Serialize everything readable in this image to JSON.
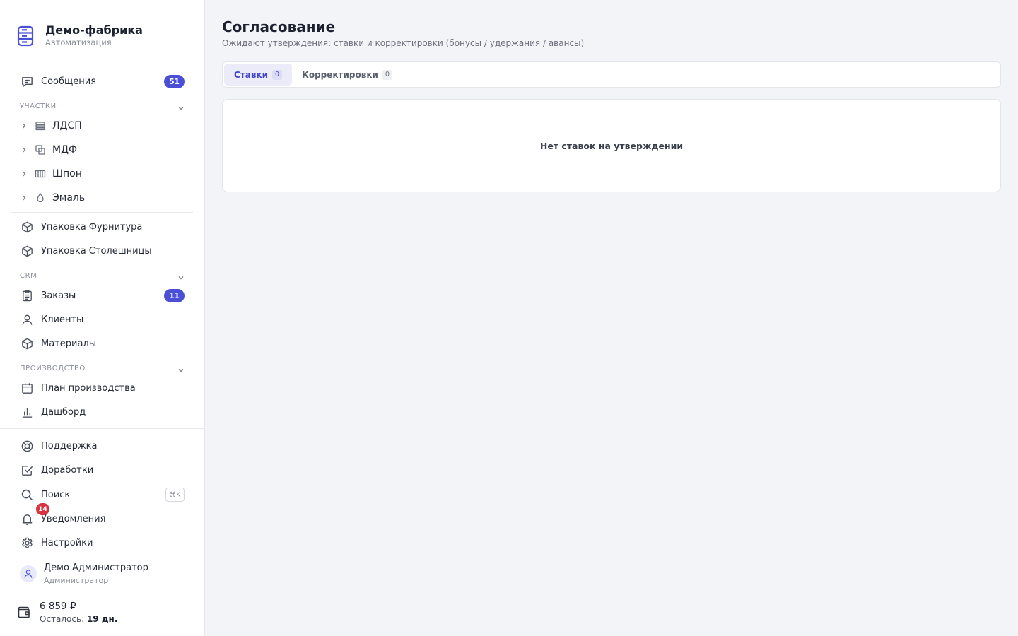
{
  "brand": {
    "title": "Демо-фабрика",
    "subtitle": "Автоматизация",
    "icon": "server-stack-icon"
  },
  "sidebar": {
    "messages": {
      "label": "Сообщения",
      "badge": "51",
      "icon": "chat-icon"
    },
    "sections": {
      "areas": "Участки",
      "crm": "CRM",
      "production": "Производство"
    },
    "areas": [
      {
        "label": "ЛДСП",
        "icon": "layers-icon"
      },
      {
        "label": "МДФ",
        "icon": "copy-squares-icon"
      },
      {
        "label": "Шпон",
        "icon": "stripes-icon"
      },
      {
        "label": "Эмаль",
        "icon": "drop-icon"
      }
    ],
    "packaging": [
      {
        "label": "Упаковка Фурнитура",
        "icon": "box-icon"
      },
      {
        "label": "Упаковка Столешницы",
        "icon": "box-icon"
      }
    ],
    "crm": [
      {
        "label": "Заказы",
        "badge": "11",
        "icon": "clipboard-icon"
      },
      {
        "label": "Клиенты",
        "icon": "user-icon"
      },
      {
        "label": "Материалы",
        "icon": "cube-icon"
      }
    ],
    "production": [
      {
        "label": "План производства",
        "icon": "calendar-icon"
      },
      {
        "label": "Дашборд",
        "icon": "bar-chart-icon"
      }
    ],
    "bottom": {
      "support": "Поддержка",
      "improvements": "Доработки",
      "search": "Поиск",
      "search_shortcut": "⌘K",
      "notifications": "Уведомления",
      "notifications_badge": "14",
      "settings": "Настройки"
    },
    "user": {
      "name": "Демо Администратор",
      "role": "Администратор"
    },
    "wallet": {
      "amount": "6 859 ₽",
      "remaining_label": "Осталось:",
      "remaining_value": "19 дн."
    }
  },
  "main": {
    "title": "Согласование",
    "subtitle": "Ожидают утверждения: ставки и корректировки (бонусы / удержания / авансы)",
    "tabs": [
      {
        "label": "Ставки",
        "count": "0",
        "active": true
      },
      {
        "label": "Корректировки",
        "count": "0",
        "active": false
      }
    ],
    "empty_message": "Нет ставок на утверждении"
  },
  "colors": {
    "accent": "#4a4fd6",
    "badge_red": "#d93340",
    "background": "#f3f4f8"
  }
}
